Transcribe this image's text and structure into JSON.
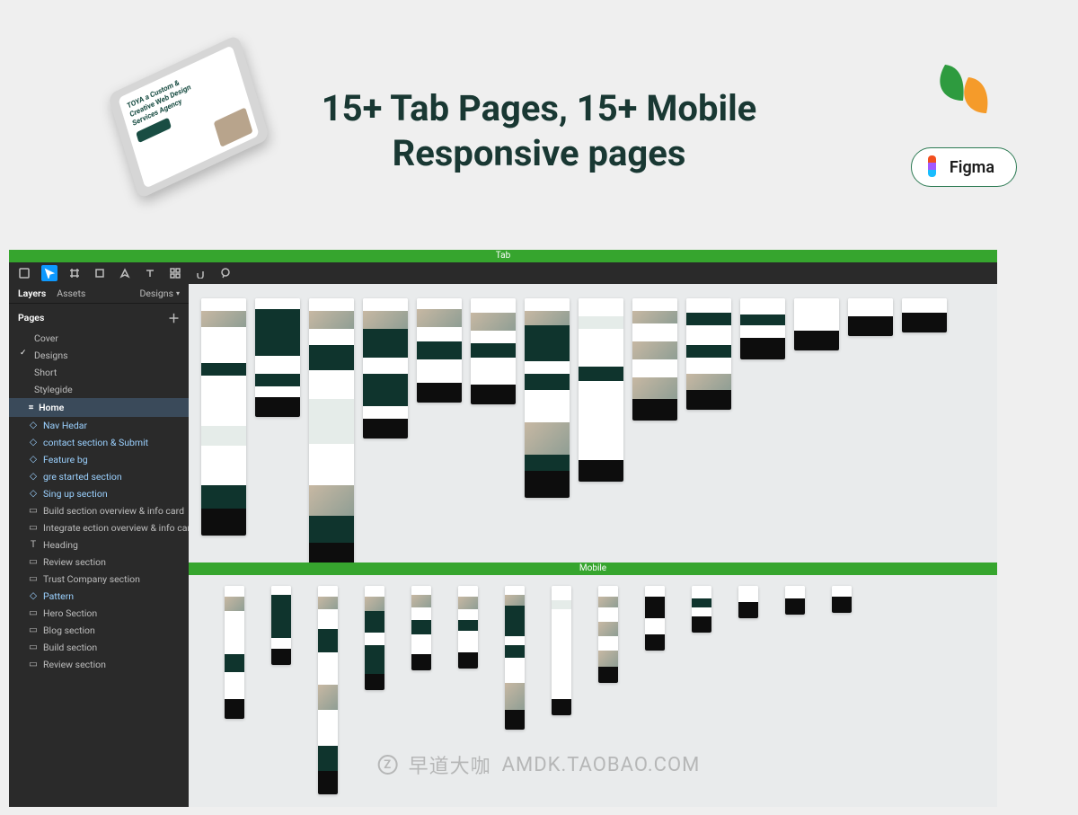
{
  "hero": {
    "title_line1": "15+ Tab Pages, 15+ Mobile",
    "title_line2": "Responsive pages",
    "figma_label": "Figma",
    "tablet_headline_l1": "TOYA a Custom &",
    "tablet_headline_l2": "Creative Web Design",
    "tablet_headline_l3": "Services Agency"
  },
  "colors": {
    "accent_green": "#36a52e",
    "brand_dark": "#194d43",
    "leaf_green": "#2e9b3f",
    "leaf_orange": "#f59b2a",
    "figma_blue": "#0d99ff"
  },
  "editor": {
    "section_tab": "Tab",
    "section_mobile": "Mobile",
    "panel": {
      "tab_layers": "Layers",
      "tab_assets": "Assets",
      "designs_label": "Designs",
      "pages_header": "Pages",
      "pages": [
        {
          "name": "Cover",
          "selected": false
        },
        {
          "name": "Designs",
          "selected": true
        },
        {
          "name": "Short",
          "selected": false
        },
        {
          "name": "Stylegide",
          "selected": false
        }
      ],
      "frame_name": "Home",
      "layers": [
        {
          "name": "Nav Hedar",
          "type": "component"
        },
        {
          "name": "contact section & Submit",
          "type": "component"
        },
        {
          "name": "Feature bg",
          "type": "component"
        },
        {
          "name": "gre started section",
          "type": "component"
        },
        {
          "name": "Sing up section",
          "type": "component"
        },
        {
          "name": "Build section overview & info card",
          "type": "frame"
        },
        {
          "name": "Integrate ection overview & info card",
          "type": "frame"
        },
        {
          "name": "Heading",
          "type": "text"
        },
        {
          "name": "Review section",
          "type": "frame"
        },
        {
          "name": "Trust Company section",
          "type": "frame"
        },
        {
          "name": "Pattern",
          "type": "instance"
        },
        {
          "name": "Hero Section",
          "type": "frame"
        },
        {
          "name": "Blog section",
          "type": "frame"
        },
        {
          "name": "Build section",
          "type": "frame"
        },
        {
          "name": "Review section",
          "type": "frame"
        }
      ]
    },
    "tab_artboards": [
      {
        "sections": [
          [
            "white",
            14
          ],
          [
            "photo",
            18
          ],
          [
            "white",
            40
          ],
          [
            "dark",
            14
          ],
          [
            "white",
            56
          ],
          [
            "lt",
            22
          ],
          [
            "white",
            44
          ],
          [
            "dark",
            26
          ],
          [
            "black",
            30
          ]
        ]
      },
      {
        "sections": [
          [
            "white",
            12
          ],
          [
            "dark",
            52
          ],
          [
            "white",
            20
          ],
          [
            "dark",
            14
          ],
          [
            "white",
            12
          ],
          [
            "black",
            22
          ]
        ]
      },
      {
        "sections": [
          [
            "white",
            14
          ],
          [
            "photo",
            20
          ],
          [
            "white",
            18
          ],
          [
            "dark",
            28
          ],
          [
            "white",
            32
          ],
          [
            "lt",
            50
          ],
          [
            "white",
            46
          ],
          [
            "photo",
            34
          ],
          [
            "dark",
            30
          ],
          [
            "black",
            30
          ]
        ]
      },
      {
        "sections": [
          [
            "white",
            14
          ],
          [
            "photo",
            20
          ],
          [
            "dark",
            32
          ],
          [
            "white",
            18
          ],
          [
            "dark",
            36
          ],
          [
            "white",
            14
          ],
          [
            "black",
            22
          ]
        ]
      },
      {
        "sections": [
          [
            "white",
            12
          ],
          [
            "photo",
            20
          ],
          [
            "white",
            16
          ],
          [
            "dark",
            20
          ],
          [
            "white",
            26
          ],
          [
            "black",
            22
          ]
        ]
      },
      {
        "sections": [
          [
            "white",
            16
          ],
          [
            "photo",
            20
          ],
          [
            "white",
            14
          ],
          [
            "dark",
            16
          ],
          [
            "white",
            30
          ],
          [
            "black",
            22
          ]
        ]
      },
      {
        "sections": [
          [
            "white",
            14
          ],
          [
            "photo",
            16
          ],
          [
            "dark",
            40
          ],
          [
            "white",
            14
          ],
          [
            "dark",
            18
          ],
          [
            "white",
            36
          ],
          [
            "photo",
            36
          ],
          [
            "dark",
            18
          ],
          [
            "black",
            30
          ]
        ]
      },
      {
        "sections": [
          [
            "white",
            20
          ],
          [
            "lt",
            14
          ],
          [
            "white",
            42
          ],
          [
            "dark",
            16
          ],
          [
            "white",
            88
          ],
          [
            "black",
            24
          ]
        ]
      },
      {
        "sections": [
          [
            "white",
            14
          ],
          [
            "photo",
            14
          ],
          [
            "white",
            20
          ],
          [
            "photo",
            20
          ],
          [
            "white",
            20
          ],
          [
            "photo",
            24
          ],
          [
            "black",
            24
          ]
        ]
      },
      {
        "sections": [
          [
            "white",
            16
          ],
          [
            "dark",
            14
          ],
          [
            "white",
            22
          ],
          [
            "dark",
            14
          ],
          [
            "white",
            18
          ],
          [
            "photo",
            18
          ],
          [
            "black",
            22
          ]
        ]
      },
      {
        "sections": [
          [
            "white",
            18
          ],
          [
            "dark",
            12
          ],
          [
            "white",
            14
          ],
          [
            "black",
            24
          ]
        ]
      },
      {
        "sections": [
          [
            "white",
            24
          ],
          [
            "white",
            12
          ],
          [
            "black",
            22
          ]
        ]
      },
      {
        "sections": [
          [
            "white",
            20
          ],
          [
            "black",
            22
          ]
        ]
      },
      {
        "sections": [
          [
            "white",
            16
          ],
          [
            "black",
            22
          ]
        ]
      }
    ],
    "mobile_artboards": [
      {
        "sections": [
          [
            "white",
            12
          ],
          [
            "photo",
            16
          ],
          [
            "white",
            48
          ],
          [
            "dark",
            20
          ],
          [
            "white",
            30
          ],
          [
            "black",
            22
          ]
        ]
      },
      {
        "sections": [
          [
            "white",
            10
          ],
          [
            "dark",
            48
          ],
          [
            "white",
            12
          ],
          [
            "black",
            18
          ]
        ]
      },
      {
        "sections": [
          [
            "white",
            12
          ],
          [
            "photo",
            14
          ],
          [
            "white",
            22
          ],
          [
            "dark",
            26
          ],
          [
            "white",
            36
          ],
          [
            "photo",
            28
          ],
          [
            "white",
            40
          ],
          [
            "dark",
            28
          ],
          [
            "black",
            26
          ]
        ]
      },
      {
        "sections": [
          [
            "white",
            12
          ],
          [
            "photo",
            16
          ],
          [
            "dark",
            24
          ],
          [
            "white",
            14
          ],
          [
            "dark",
            32
          ],
          [
            "black",
            18
          ]
        ]
      },
      {
        "sections": [
          [
            "white",
            10
          ],
          [
            "photo",
            14
          ],
          [
            "white",
            14
          ],
          [
            "dark",
            16
          ],
          [
            "white",
            22
          ],
          [
            "black",
            18
          ]
        ]
      },
      {
        "sections": [
          [
            "white",
            12
          ],
          [
            "photo",
            14
          ],
          [
            "white",
            12
          ],
          [
            "dark",
            12
          ],
          [
            "white",
            24
          ],
          [
            "black",
            18
          ]
        ]
      },
      {
        "sections": [
          [
            "white",
            10
          ],
          [
            "photo",
            12
          ],
          [
            "dark",
            34
          ],
          [
            "white",
            10
          ],
          [
            "dark",
            14
          ],
          [
            "white",
            28
          ],
          [
            "photo",
            30
          ],
          [
            "black",
            22
          ]
        ]
      },
      {
        "sections": [
          [
            "white",
            16
          ],
          [
            "lt",
            10
          ],
          [
            "white",
            30
          ],
          [
            "white",
            70
          ],
          [
            "black",
            18
          ]
        ]
      },
      {
        "sections": [
          [
            "white",
            12
          ],
          [
            "photo",
            12
          ],
          [
            "white",
            16
          ],
          [
            "photo",
            16
          ],
          [
            "white",
            16
          ],
          [
            "photo",
            18
          ],
          [
            "black",
            18
          ]
        ]
      },
      {
        "sections": [
          [
            "white",
            12
          ],
          [
            "black",
            24
          ],
          [
            "white",
            18
          ],
          [
            "black",
            18
          ]
        ]
      },
      {
        "sections": [
          [
            "white",
            14
          ],
          [
            "dark",
            10
          ],
          [
            "white",
            10
          ],
          [
            "black",
            18
          ]
        ]
      },
      {
        "sections": [
          [
            "white",
            18
          ],
          [
            "black",
            18
          ]
        ]
      },
      {
        "sections": [
          [
            "white",
            14
          ],
          [
            "black",
            18
          ]
        ]
      },
      {
        "sections": [
          [
            "white",
            12
          ],
          [
            "black",
            18
          ]
        ]
      }
    ]
  },
  "watermark": {
    "icon_letter": "Z",
    "text_cn": "早道大咖",
    "text_url": "AMDK.TAOBAO.COM"
  }
}
